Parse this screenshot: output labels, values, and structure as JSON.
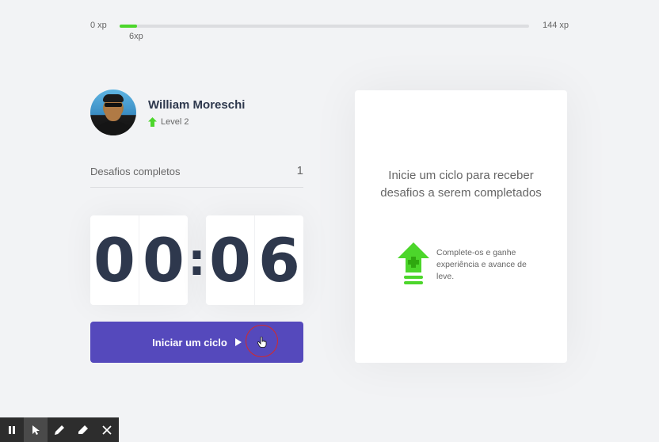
{
  "xp": {
    "min_label": "0 xp",
    "max_label": "144 xp",
    "current_label": "6xp",
    "progress_fraction": 0.042,
    "fill_color": "#4cd62b"
  },
  "profile": {
    "name": "William Moreschi",
    "level_label": "Level 2",
    "level_icon": "level-up-arrow-icon"
  },
  "challenges": {
    "label": "Desafios completos",
    "count": "1"
  },
  "countdown": {
    "minute_left": "0",
    "minute_right": "0",
    "separator": ":",
    "second_left": "0",
    "second_right": "6"
  },
  "start_button": {
    "label": "Iniciar um ciclo",
    "icon": "play-icon",
    "color": "#5549bc"
  },
  "challenge_card": {
    "title": "Inicie um ciclo para receber desafios a serem completados",
    "hint": "Complete-os e ganhe experiência e avance de leve.",
    "icon": "level-up-icon"
  },
  "toolbar": {
    "tools": [
      "pause-icon",
      "pointer-icon",
      "pencil-icon",
      "eraser-icon",
      "close-icon"
    ]
  },
  "colors": {
    "background": "#f2f3f5",
    "title": "#2e384d",
    "text": "#666666",
    "green": "#4cd62b",
    "blue": "#5549bc"
  }
}
